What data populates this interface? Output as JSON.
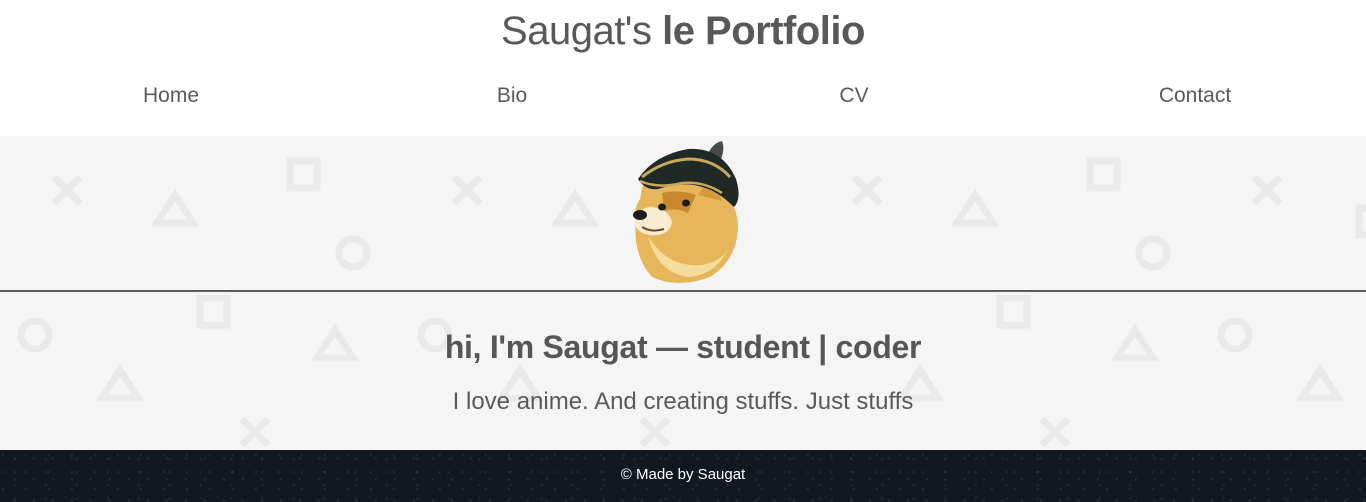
{
  "header": {
    "title_prefix": "Saugat's",
    "title_strong": "le Portfolio"
  },
  "nav": {
    "items": [
      {
        "label": "Home"
      },
      {
        "label": "Bio"
      },
      {
        "label": "CV"
      },
      {
        "label": "Contact"
      }
    ]
  },
  "hero": {
    "avatar_icon": "doge-pirate-hat-avatar"
  },
  "main": {
    "headline": "hi, I'm Saugat — student | coder",
    "subline": "I love anime. And creating stuffs. Just stuffs"
  },
  "footer": {
    "text": "© Made by Saugat"
  },
  "colors": {
    "text": "#555555",
    "pattern_bg": "#f5f5f5",
    "pattern_shape": "#e9e9e9",
    "divider": "#5b5b5b",
    "footer_bg": "#121820",
    "footer_text": "#ffffff"
  }
}
